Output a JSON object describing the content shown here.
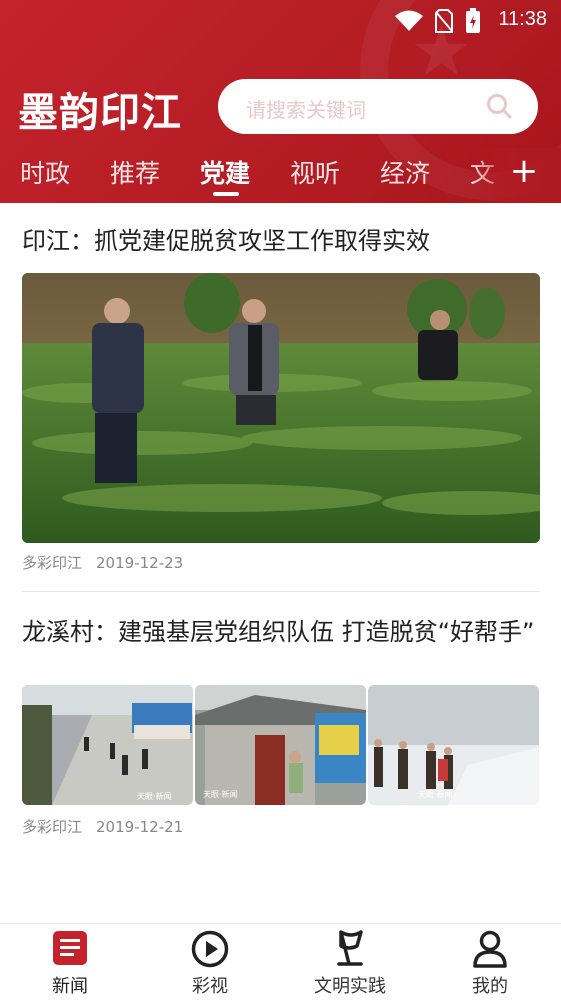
{
  "status": {
    "time": "11:38"
  },
  "header": {
    "brand": "墨韵印江",
    "search_placeholder": "请搜索关键词",
    "tabs": [
      "时政",
      "推荐",
      "党建",
      "视听",
      "经济",
      "文"
    ],
    "active_tab": "党建",
    "add_label": "+"
  },
  "articles": [
    {
      "title": "印江：抓党建促脱贫攻坚工作取得实效",
      "source": "多彩印江",
      "date": "2019-12-23"
    },
    {
      "title": "龙溪村：建强基层党组织队伍 打造脱贫“好帮手”",
      "source": "多彩印江",
      "date": "2019-12-21"
    }
  ],
  "bottom_nav": [
    {
      "label": "新闻",
      "icon": "news-icon",
      "active": true
    },
    {
      "label": "彩视",
      "icon": "play-icon",
      "active": false
    },
    {
      "label": "文明实践",
      "icon": "flag-icon",
      "active": false
    },
    {
      "label": "我的",
      "icon": "user-icon",
      "active": false
    }
  ],
  "colors": {
    "brand_red": "#b51d25",
    "text_dark": "#222222",
    "meta_gray": "#888888"
  }
}
